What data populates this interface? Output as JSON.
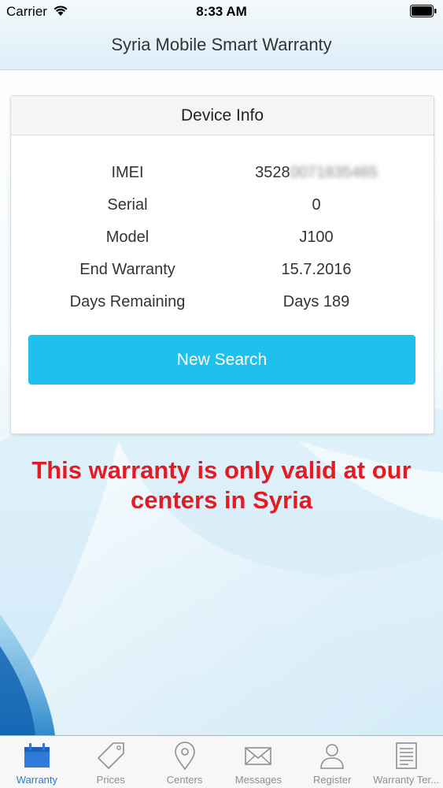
{
  "status_bar": {
    "carrier": "Carrier",
    "time": "8:33 AM"
  },
  "nav": {
    "title": "Syria Mobile Smart Warranty"
  },
  "device_info": {
    "header": "Device Info",
    "rows": [
      {
        "label": "IMEI",
        "value": "3528",
        "value_obscured": "0071835465"
      },
      {
        "label": "Serial",
        "value": "0"
      },
      {
        "label": "Model",
        "value": "J100"
      },
      {
        "label": "End Warranty",
        "value": "15.7.2016"
      },
      {
        "label": "Days Remaining",
        "value": "Days 189"
      }
    ],
    "new_search_label": "New Search"
  },
  "notice": {
    "text": "This warranty is only valid at our centers in Syria"
  },
  "tabbar": {
    "active": "warranty",
    "tabs": [
      {
        "id": "warranty",
        "label": "Warranty",
        "icon": "calendar-icon"
      },
      {
        "id": "prices",
        "label": "Prices",
        "icon": "price-tag-icon"
      },
      {
        "id": "centers",
        "label": "Centers",
        "icon": "map-pin-icon"
      },
      {
        "id": "messages",
        "label": "Messages",
        "icon": "envelope-icon"
      },
      {
        "id": "register",
        "label": "Register",
        "icon": "user-icon"
      },
      {
        "id": "warranty-terms",
        "label": "Warranty Ter...",
        "icon": "document-icon"
      }
    ]
  },
  "colors": {
    "accent": "#1ec0ee",
    "tab_active": "#2f7ad8",
    "notice": "#e31b23"
  }
}
